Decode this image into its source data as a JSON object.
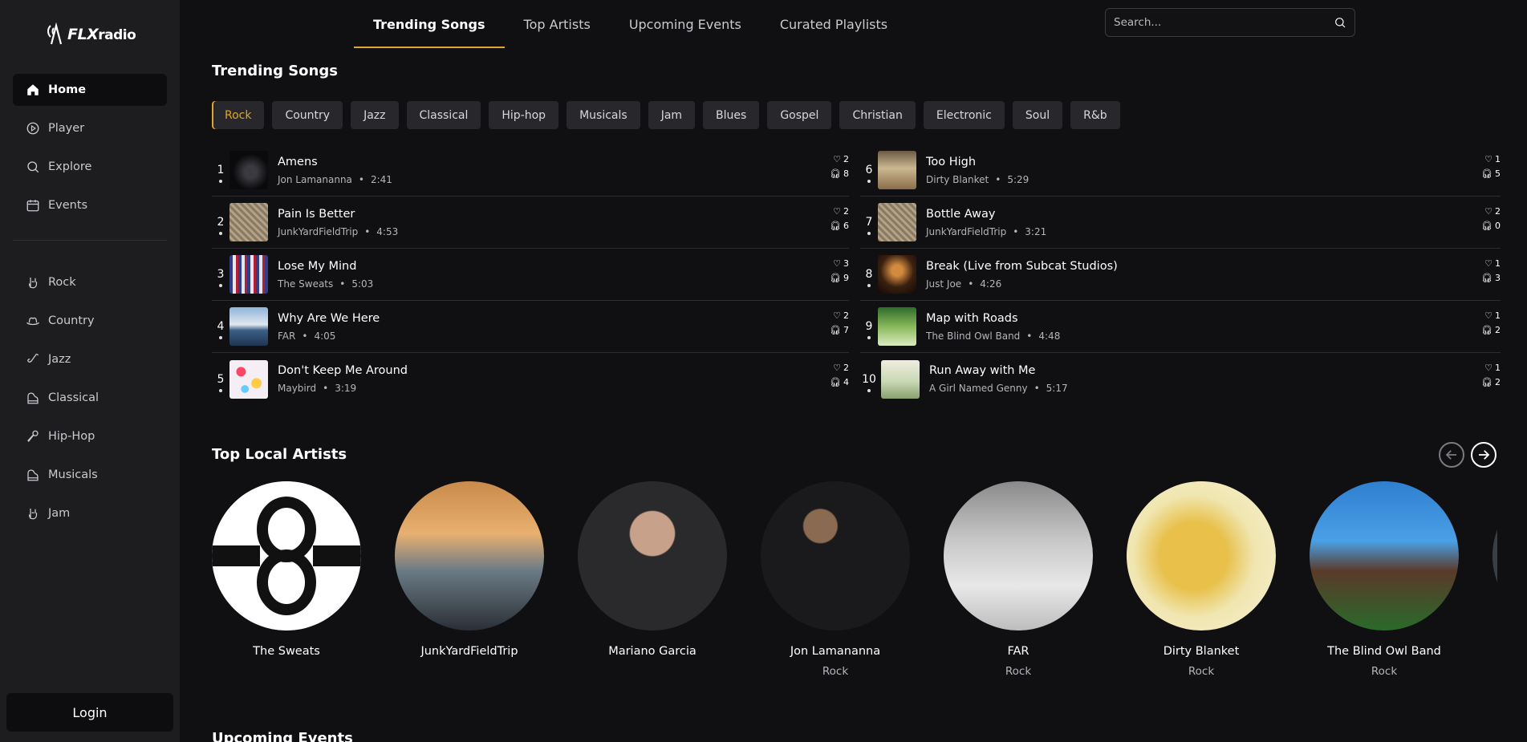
{
  "brand": {
    "name_main": "FLX",
    "name_sub": "radio"
  },
  "sidebar": {
    "main_items": [
      {
        "label": "Home",
        "icon": "home-icon",
        "active": true
      },
      {
        "label": "Player",
        "icon": "play-circle-icon"
      },
      {
        "label": "Explore",
        "icon": "search-icon"
      },
      {
        "label": "Events",
        "icon": "calendar-icon"
      }
    ],
    "genre_items": [
      {
        "label": "Rock",
        "icon": "rock-hand-icon"
      },
      {
        "label": "Country",
        "icon": "cowboy-hat-icon"
      },
      {
        "label": "Jazz",
        "icon": "saxophone-icon"
      },
      {
        "label": "Classical",
        "icon": "piano-icon"
      },
      {
        "label": "Hip-Hop",
        "icon": "microphone-icon"
      },
      {
        "label": "Musicals",
        "icon": "piano-icon"
      },
      {
        "label": "Jam",
        "icon": "rock-hand-icon"
      }
    ],
    "login_label": "Login"
  },
  "tabs": [
    {
      "label": "Trending Songs",
      "active": true
    },
    {
      "label": "Top Artists"
    },
    {
      "label": "Upcoming Events"
    },
    {
      "label": "Curated Playlists"
    }
  ],
  "search": {
    "placeholder": "Search..."
  },
  "trending": {
    "title": "Trending Songs",
    "genres": [
      "Rock",
      "Country",
      "Jazz",
      "Classical",
      "Hip-hop",
      "Musicals",
      "Jam",
      "Blues",
      "Gospel",
      "Christian",
      "Electronic",
      "Soul",
      "R&b"
    ],
    "active_genre": "Rock",
    "songs_left": [
      {
        "rank": "1",
        "title": "Amens",
        "artist": "Jon Lamananna",
        "duration": "2:41",
        "likes": "2",
        "plays": "8"
      },
      {
        "rank": "2",
        "title": "Pain Is Better",
        "artist": "JunkYardFieldTrip",
        "duration": "4:53",
        "likes": "2",
        "plays": "6"
      },
      {
        "rank": "3",
        "title": "Lose My Mind",
        "artist": "The Sweats",
        "duration": "5:03",
        "likes": "3",
        "plays": "9"
      },
      {
        "rank": "4",
        "title": "Why Are We Here",
        "artist": "FAR",
        "duration": "4:05",
        "likes": "2",
        "plays": "7"
      },
      {
        "rank": "5",
        "title": "Don't Keep Me Around",
        "artist": "Maybird",
        "duration": "3:19",
        "likes": "2",
        "plays": "4"
      }
    ],
    "songs_right": [
      {
        "rank": "6",
        "title": "Too High",
        "artist": "Dirty Blanket",
        "duration": "5:29",
        "likes": "1",
        "plays": "5"
      },
      {
        "rank": "7",
        "title": "Bottle Away",
        "artist": "JunkYardFieldTrip",
        "duration": "3:21",
        "likes": "2",
        "plays": "0"
      },
      {
        "rank": "8",
        "title": "Break (Live from Subcat Studios)",
        "artist": "Just Joe",
        "duration": "4:26",
        "likes": "1",
        "plays": "3"
      },
      {
        "rank": "9",
        "title": "Map with Roads",
        "artist": "The Blind Owl Band",
        "duration": "4:48",
        "likes": "1",
        "plays": "2"
      },
      {
        "rank": "10",
        "title": "Run Away with Me",
        "artist": "A Girl Named Genny",
        "duration": "5:17",
        "likes": "1",
        "plays": "2"
      }
    ]
  },
  "artists": {
    "title": "Top Local Artists",
    "items": [
      {
        "name": "The Sweats",
        "genre": ""
      },
      {
        "name": "JunkYardFieldTrip",
        "genre": ""
      },
      {
        "name": "Mariano Garcia",
        "genre": ""
      },
      {
        "name": "Jon Lamananna",
        "genre": "Rock"
      },
      {
        "name": "FAR",
        "genre": "Rock"
      },
      {
        "name": "Dirty Blanket",
        "genre": "Rock"
      },
      {
        "name": "The Blind Owl Band",
        "genre": "Rock"
      }
    ]
  },
  "events": {
    "title": "Upcoming Events"
  },
  "colors": {
    "accent": "#e0a52a",
    "sidebar_bg": "#1d1d20",
    "page_bg": "#101012"
  }
}
